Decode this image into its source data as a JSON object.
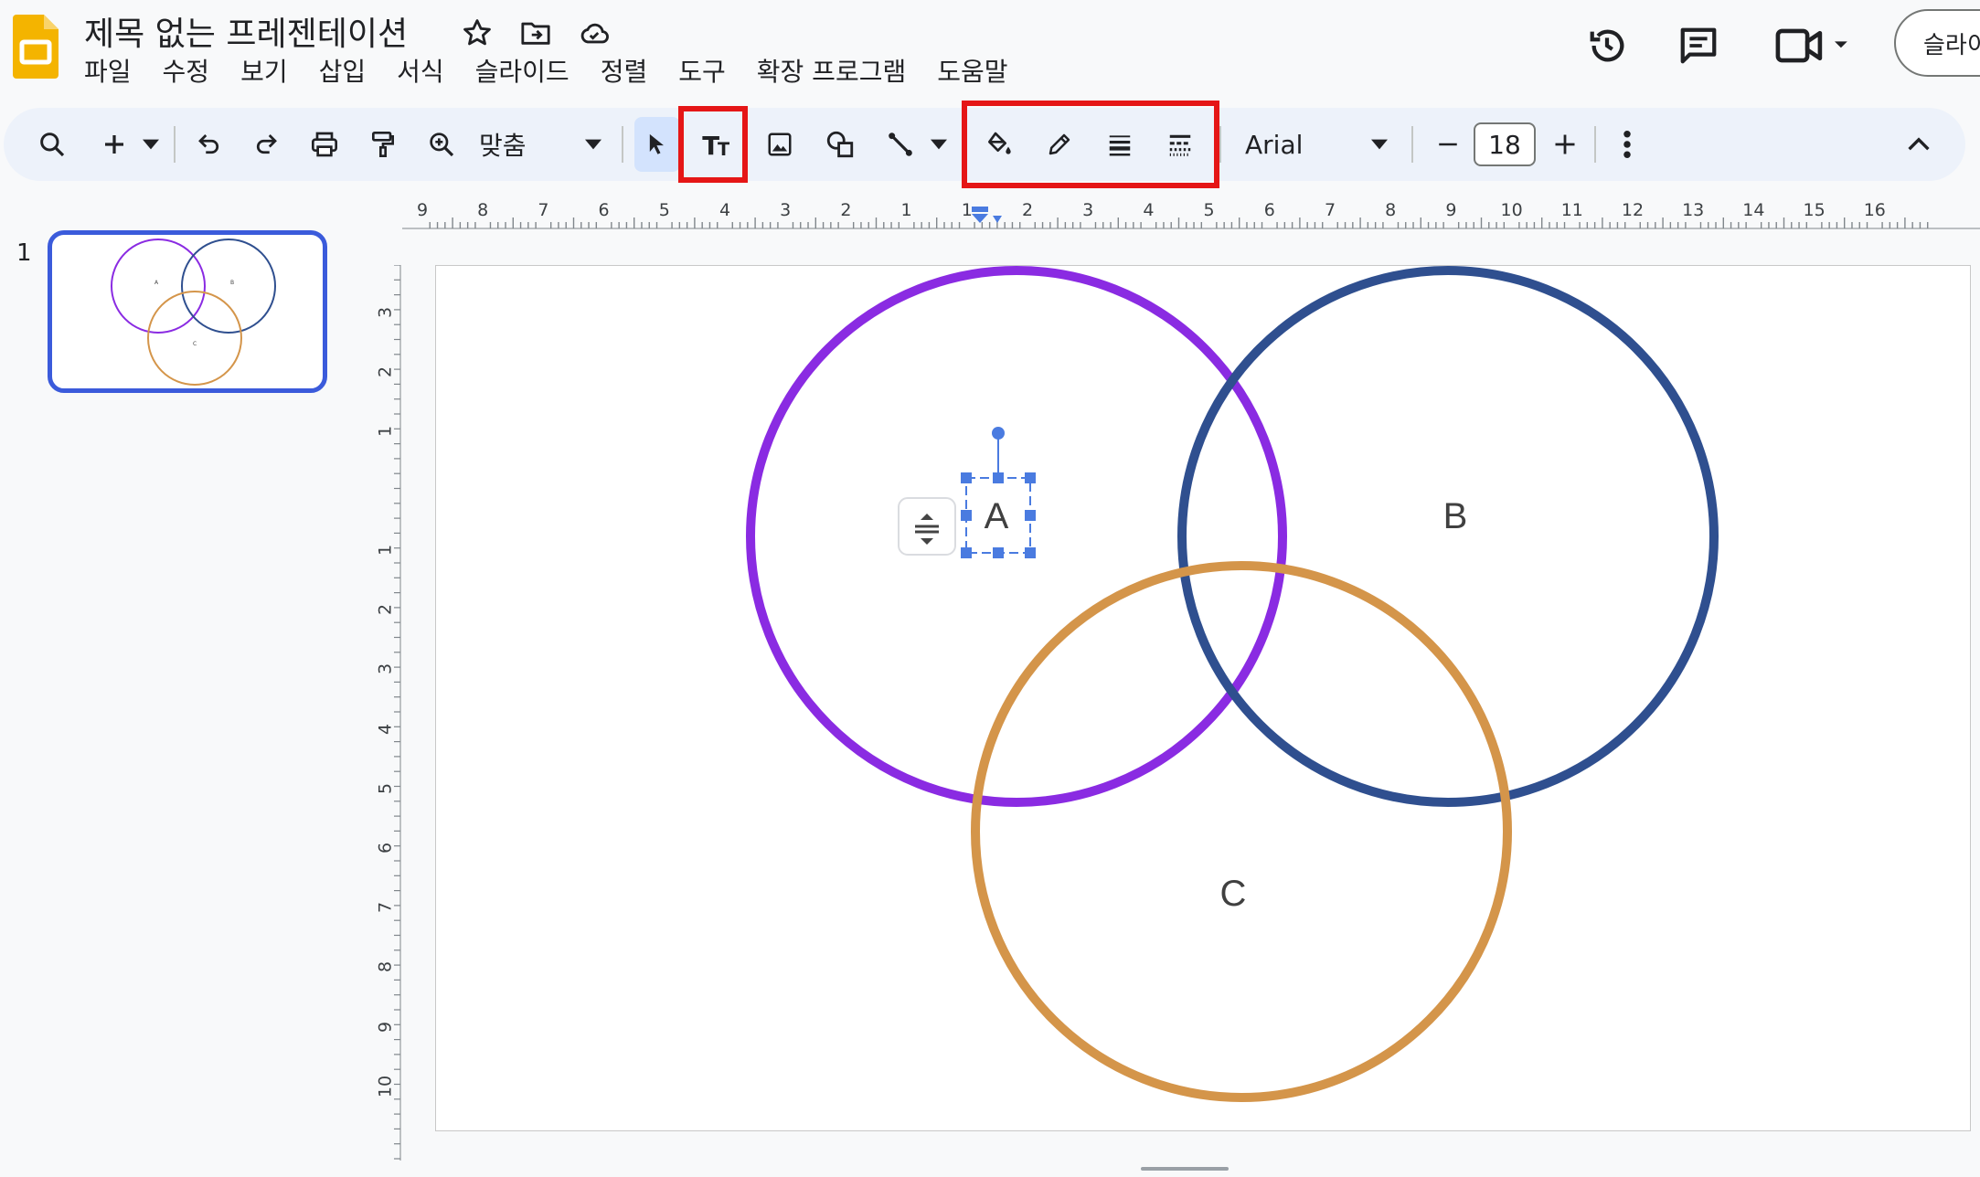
{
  "header": {
    "doc_title": "제목 없는 프레젠테이션",
    "menu": [
      "파일",
      "수정",
      "보기",
      "삽입",
      "서식",
      "슬라이드",
      "정렬",
      "도구",
      "확장 프로그램",
      "도움말"
    ],
    "slideshow_label": "슬라이"
  },
  "toolbar": {
    "zoom_label": "맞춤",
    "font_name": "Arial",
    "font_size": "18",
    "highlight_color": "#e51616"
  },
  "filmstrip": {
    "slide_number": "1",
    "thumb_labels": [
      "A",
      "B",
      "C"
    ]
  },
  "rulers": {
    "horizontal_ticks": [
      "9",
      "8",
      "7",
      "6",
      "5",
      "4",
      "3",
      "2",
      "1",
      "1",
      "2",
      "3",
      "4",
      "5",
      "6",
      "7",
      "8",
      "9",
      "10",
      "11",
      "12",
      "13",
      "14",
      "15",
      "16"
    ],
    "vertical_ticks": [
      "3",
      "2",
      "1",
      "1",
      "2",
      "3",
      "4",
      "5",
      "6",
      "7",
      "8",
      "9",
      "10"
    ]
  },
  "slide": {
    "circles": [
      {
        "label": "A",
        "color": "#8a2be2"
      },
      {
        "label": "B",
        "color": "#2f4f8f"
      },
      {
        "label": "C",
        "color": "#d4954a"
      }
    ]
  }
}
